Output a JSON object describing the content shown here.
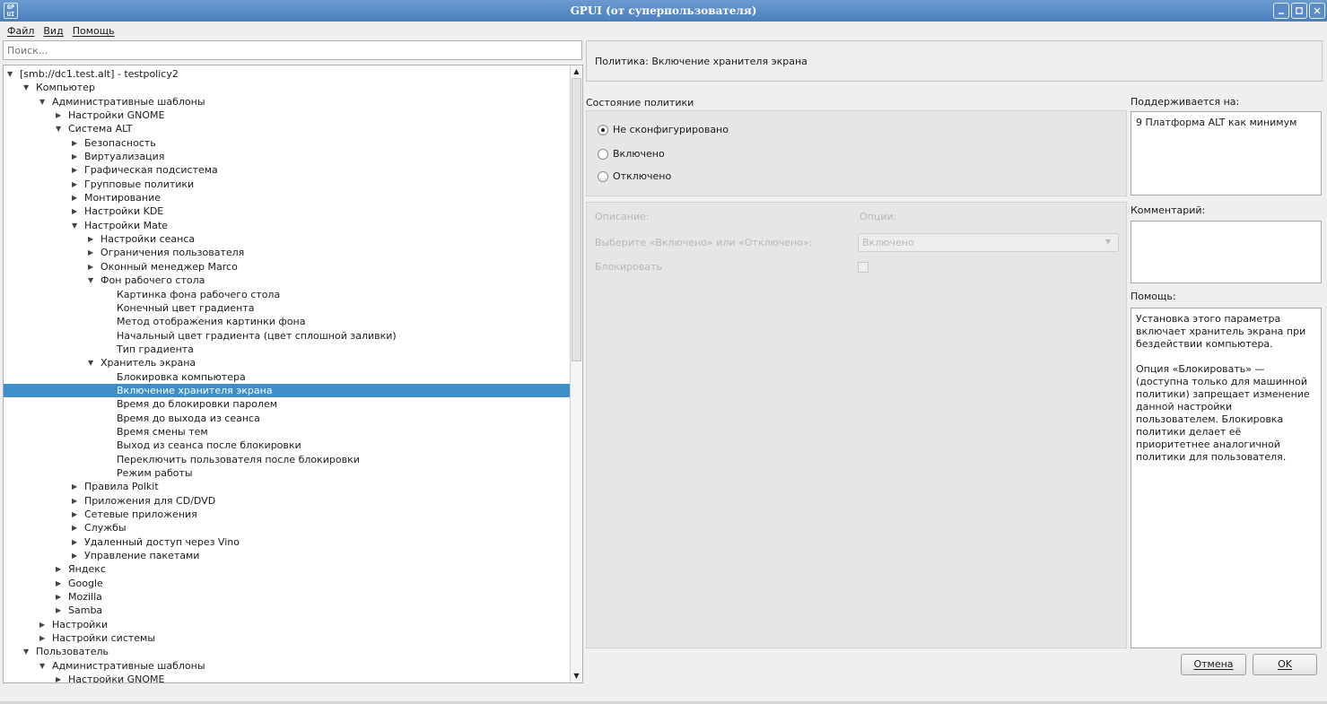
{
  "window": {
    "title": "GPUI (от суперпользователя)",
    "icon_text": "GP\nUI"
  },
  "menu": [
    {
      "label": "Файл"
    },
    {
      "label": "Вид"
    },
    {
      "label": "Помощь"
    }
  ],
  "search": {
    "placeholder": "Поиск..."
  },
  "tree": [
    {
      "label": "[smb://dc1.test.alt] - testpolicy2",
      "level": 0,
      "arrow": "down"
    },
    {
      "label": "Компьютер",
      "level": 1,
      "arrow": "down"
    },
    {
      "label": "Административные шаблоны",
      "level": 2,
      "arrow": "down"
    },
    {
      "label": "Настройки GNOME",
      "level": 3,
      "arrow": "right"
    },
    {
      "label": "Система ALT",
      "level": 3,
      "arrow": "down"
    },
    {
      "label": "Безопасность",
      "level": 4,
      "arrow": "right"
    },
    {
      "label": "Виртуализация",
      "level": 4,
      "arrow": "right"
    },
    {
      "label": "Графическая подсистема",
      "level": 4,
      "arrow": "right"
    },
    {
      "label": "Групповые политики",
      "level": 4,
      "arrow": "right"
    },
    {
      "label": "Монтирование",
      "level": 4,
      "arrow": "right"
    },
    {
      "label": "Настройки KDE",
      "level": 4,
      "arrow": "right"
    },
    {
      "label": "Настройки Mate",
      "level": 4,
      "arrow": "down"
    },
    {
      "label": "Настройки сеанса",
      "level": 5,
      "arrow": "right"
    },
    {
      "label": "Ограничения пользователя",
      "level": 5,
      "arrow": "right"
    },
    {
      "label": "Оконный менеджер Marco",
      "level": 5,
      "arrow": "right"
    },
    {
      "label": "Фон рабочего стола",
      "level": 5,
      "arrow": "down"
    },
    {
      "label": "Картинка фона рабочего стола",
      "level": 6,
      "arrow": "none"
    },
    {
      "label": "Конечный цвет градиента",
      "level": 6,
      "arrow": "none"
    },
    {
      "label": "Метод отображения картинки фона",
      "level": 6,
      "arrow": "none"
    },
    {
      "label": "Начальный цвет градиента (цвет сплошной заливки)",
      "level": 6,
      "arrow": "none"
    },
    {
      "label": "Тип градиента",
      "level": 6,
      "arrow": "none"
    },
    {
      "label": "Хранитель экрана",
      "level": 5,
      "arrow": "down"
    },
    {
      "label": "Блокировка компьютера",
      "level": 6,
      "arrow": "none"
    },
    {
      "label": "Включение хранителя экрана",
      "level": 6,
      "arrow": "none",
      "selected": true
    },
    {
      "label": "Время до блокировки паролем",
      "level": 6,
      "arrow": "none"
    },
    {
      "label": "Время до выхода из сеанса",
      "level": 6,
      "arrow": "none"
    },
    {
      "label": "Время смены тем",
      "level": 6,
      "arrow": "none"
    },
    {
      "label": "Выход из сеанса после блокировки",
      "level": 6,
      "arrow": "none"
    },
    {
      "label": "Переключить пользователя после блокировки",
      "level": 6,
      "arrow": "none"
    },
    {
      "label": "Режим работы",
      "level": 6,
      "arrow": "none"
    },
    {
      "label": "Правила Polkit",
      "level": 4,
      "arrow": "right"
    },
    {
      "label": "Приложения для CD/DVD",
      "level": 4,
      "arrow": "right"
    },
    {
      "label": "Сетевые приложения",
      "level": 4,
      "arrow": "right"
    },
    {
      "label": "Службы",
      "level": 4,
      "arrow": "right"
    },
    {
      "label": "Удаленный доступ через Vino",
      "level": 4,
      "arrow": "right"
    },
    {
      "label": "Управление пакетами",
      "level": 4,
      "arrow": "right"
    },
    {
      "label": "Яндекс",
      "level": 3,
      "arrow": "right"
    },
    {
      "label": "Google",
      "level": 3,
      "arrow": "right"
    },
    {
      "label": "Mozilla",
      "level": 3,
      "arrow": "right"
    },
    {
      "label": "Samba",
      "level": 3,
      "arrow": "right"
    },
    {
      "label": "Настройки",
      "level": 2,
      "arrow": "right"
    },
    {
      "label": "Настройки системы",
      "level": 2,
      "arrow": "right"
    },
    {
      "label": "Пользователь",
      "level": 1,
      "arrow": "down"
    },
    {
      "label": "Административные шаблоны",
      "level": 2,
      "arrow": "down"
    },
    {
      "label": "Настройки GNOME",
      "level": 3,
      "arrow": "right"
    }
  ],
  "policy": {
    "header": "Политика: Включение хранителя экрана",
    "state_label": "Состояние политики",
    "states": [
      {
        "label": "Не сконфигурировано",
        "checked": true
      },
      {
        "label": "Включено",
        "checked": false
      },
      {
        "label": "Отключено",
        "checked": false
      }
    ],
    "description_label": "Описание:",
    "options_label": "Опции:",
    "choose_label": "Выберите «Включено» или «Отключено»:",
    "choose_value": "Включено",
    "block_label": "Блокировать",
    "block_checked": false
  },
  "side": {
    "supported_label": "Поддерживается на:",
    "supported_value": "9 Платформа ALT как минимум",
    "comment_label": "Комментарий:",
    "comment_value": "",
    "help_label": "Помощь:",
    "help_text": "Установка этого параметра включает хранитель экрана при бездействии компьютера.\n\nОпция «Блокировать» — (доступна только для машинной политики) запрещает изменение данной настройки пользователем. Блокировка политики делает её приоритетнее аналогичной политики для пользователя."
  },
  "buttons": {
    "cancel": "Отмена",
    "ok": "OK"
  },
  "colors": {
    "titlebar": "#4b7fbd",
    "selection": "#3d8ec9"
  }
}
